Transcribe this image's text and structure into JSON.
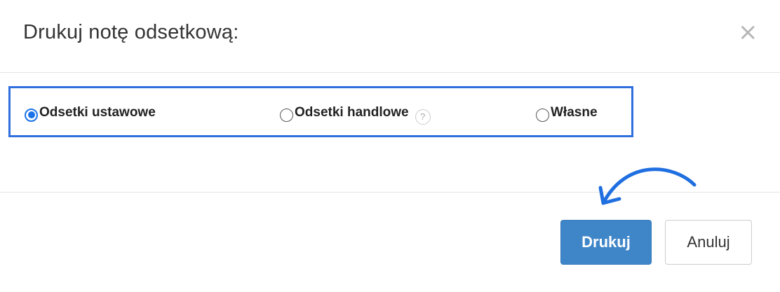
{
  "dialog": {
    "title": "Drukuj notę odsetkową:",
    "close_glyph": "×"
  },
  "options": [
    {
      "label": "Odsetki ustawowe",
      "checked": true
    },
    {
      "label": "Odsetki handlowe",
      "checked": false,
      "help": "?"
    },
    {
      "label": "Własne",
      "checked": false
    }
  ],
  "footer": {
    "print_label": "Drukuj",
    "cancel_label": "Anuluj"
  },
  "colors": {
    "highlight_border": "#2f6fde",
    "primary_button": "#3f86c8",
    "radio_checked": "#1a73e8",
    "arrow": "#1f6fe0"
  },
  "icons": [
    "close-icon",
    "help-icon",
    "curved-arrow-icon"
  ]
}
